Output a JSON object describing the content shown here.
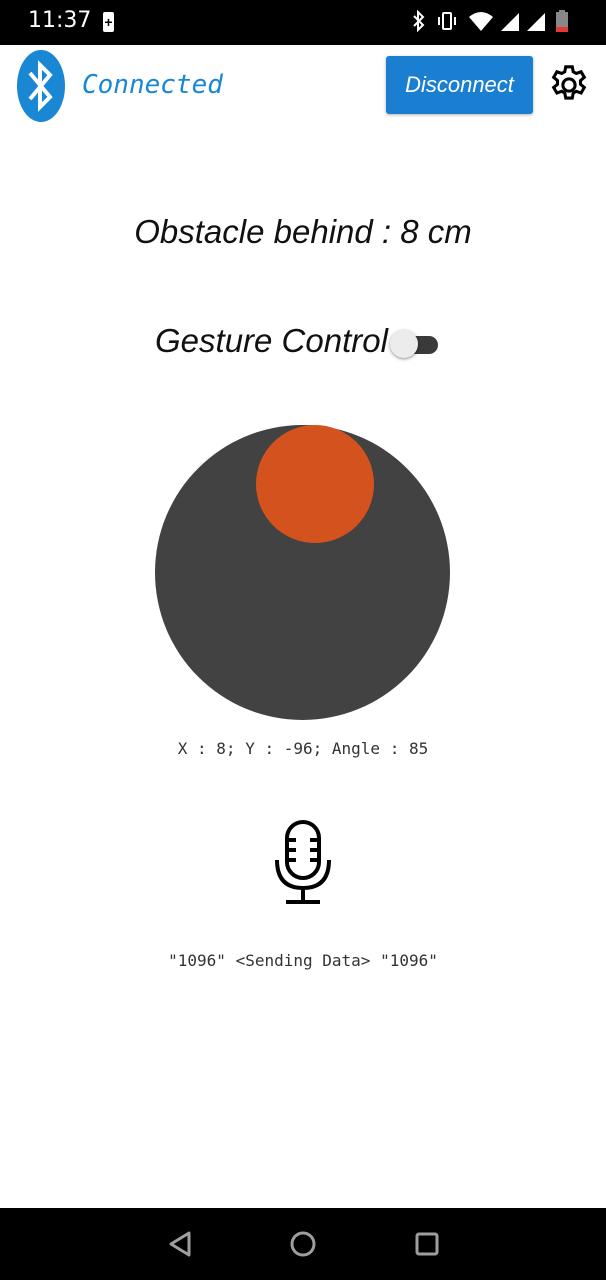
{
  "status_bar": {
    "time": "11:37",
    "icons": [
      "battery-saver-icon",
      "bluetooth-icon",
      "vibrate-icon",
      "wifi-icon",
      "signal-icon",
      "signal-icon",
      "battery-icon"
    ]
  },
  "header": {
    "connection_status": "Connected",
    "disconnect_label": "Disconnect",
    "brand_color": "#1a87d4",
    "button_color": "#1a7fd0"
  },
  "obstacle": {
    "text": "Obstacle behind : 8 cm"
  },
  "gesture_control": {
    "label": "Gesture Control",
    "enabled": false
  },
  "joystick": {
    "base_color": "#424242",
    "knob_color": "#d4521d",
    "readout": "X : 8; Y : -96; Angle : 85"
  },
  "voice": {
    "icon": "microphone-icon",
    "status": "\"1096\" <Sending Data> \"1096\""
  },
  "nav_bar": {
    "buttons": [
      "back-icon",
      "home-icon",
      "recents-icon"
    ]
  }
}
